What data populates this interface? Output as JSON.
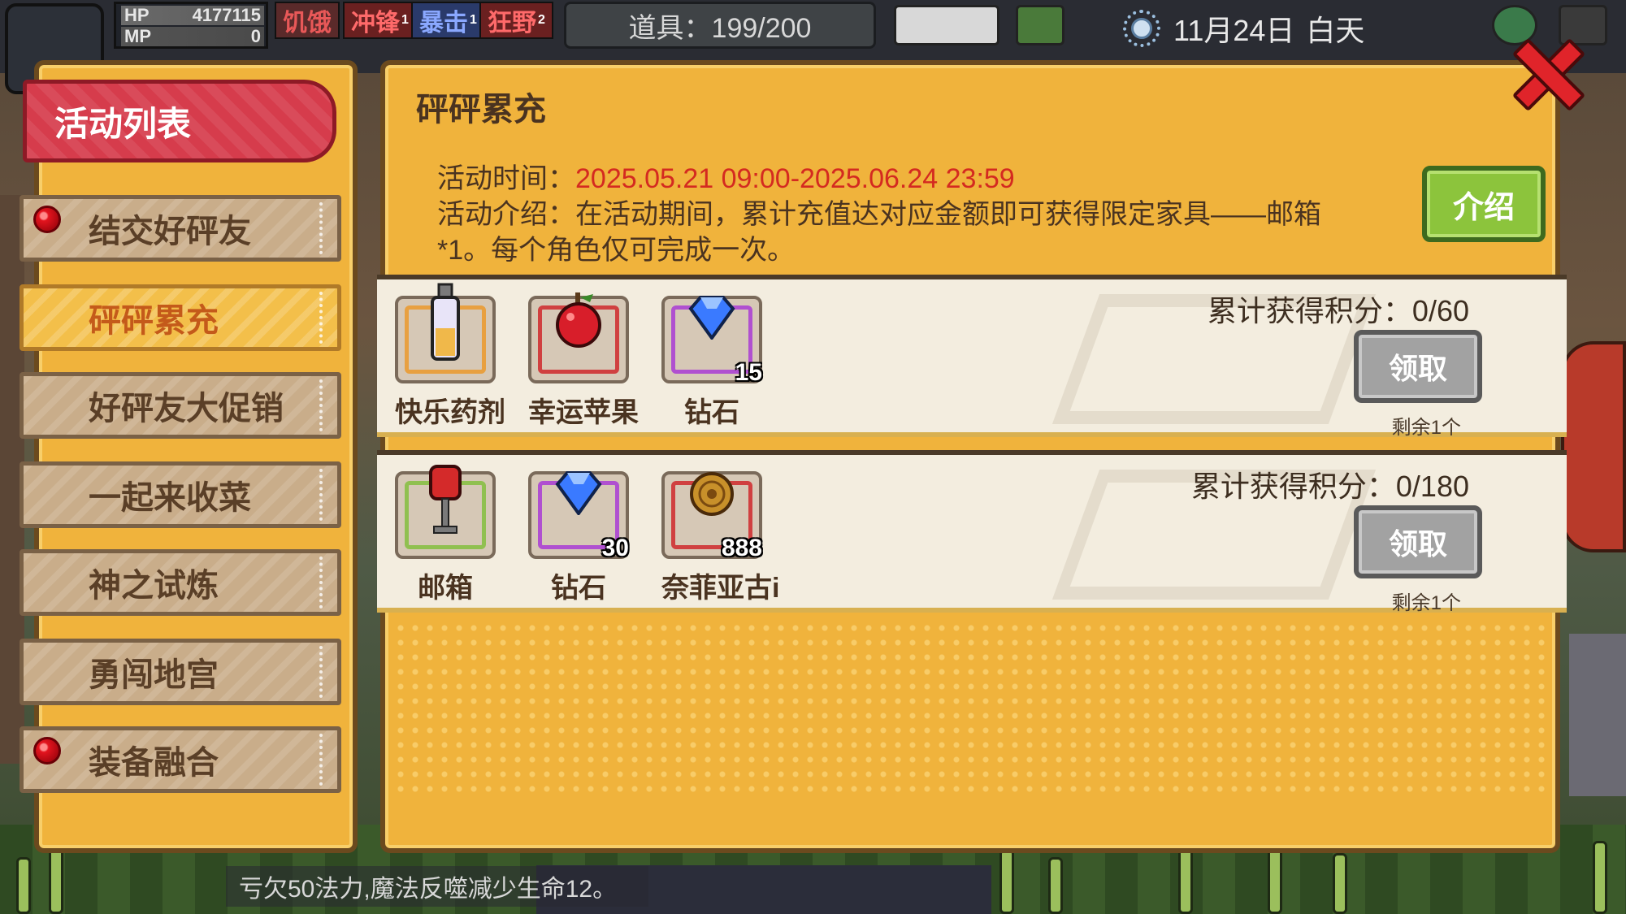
{
  "hud": {
    "hp_label": "HP",
    "hp_value": "4177115",
    "mp_label": "MP",
    "mp_value": "0",
    "status": [
      {
        "label": "饥饿",
        "level": "",
        "color": "#c24a4a"
      },
      {
        "label": "冲锋",
        "level": "1",
        "color": "#b23a3a"
      },
      {
        "label": "暴击",
        "level": "1",
        "color": "#4a6aa8"
      },
      {
        "label": "狂野",
        "level": "2",
        "color": "#b23a3a"
      }
    ],
    "items": "道具：199/200",
    "date": "11月24日",
    "time_of_day": "白天"
  },
  "sidebar": {
    "header": "活动列表",
    "items": [
      {
        "label": "结交好砰友",
        "badge": true,
        "active": false
      },
      {
        "label": "砰砰累充",
        "badge": false,
        "active": true
      },
      {
        "label": "好砰友大促销",
        "badge": false,
        "active": false
      },
      {
        "label": "一起来收菜",
        "badge": false,
        "active": false
      },
      {
        "label": "神之试炼",
        "badge": false,
        "active": false
      },
      {
        "label": "勇闯地宫",
        "badge": false,
        "active": false
      },
      {
        "label": "装备融合",
        "badge": true,
        "active": false
      }
    ]
  },
  "main": {
    "title": "砰砰累充",
    "time_label": "活动时间：",
    "time_value": "2025.05.21 09:00-2025.06.24 23:59",
    "intro_line1": "活动介绍：在活动期间，累计充值达对应金额即可获得限定家具——邮箱",
    "intro_line2": "*1。每个角色仅可完成一次。",
    "intro_button": "介绍",
    "rows": [
      {
        "score": "累计获得积分：0/60",
        "claim": "领取",
        "remain": "剩余1个",
        "rewards": [
          {
            "name": "快乐药剂",
            "count": "",
            "icon": "potion-icon",
            "frame": "#e8a040"
          },
          {
            "name": "幸运苹果",
            "count": "",
            "icon": "apple-icon",
            "frame": "#d04040"
          },
          {
            "name": "钻石",
            "count": "15",
            "icon": "diamond-icon",
            "frame": "#b050d0"
          }
        ]
      },
      {
        "score": "累计获得积分：0/180",
        "claim": "领取",
        "remain": "剩余1个",
        "rewards": [
          {
            "name": "邮箱",
            "count": "",
            "icon": "mailbox-icon",
            "frame": "#90c050"
          },
          {
            "name": "钻石",
            "count": "30",
            "icon": "diamond-icon",
            "frame": "#b050d0"
          },
          {
            "name": "奈菲亚古i",
            "count": "888",
            "icon": "coin-icon",
            "frame": "#d04040"
          }
        ]
      }
    ]
  },
  "message": "亏欠50法力,魔法反噬减少生命12。"
}
